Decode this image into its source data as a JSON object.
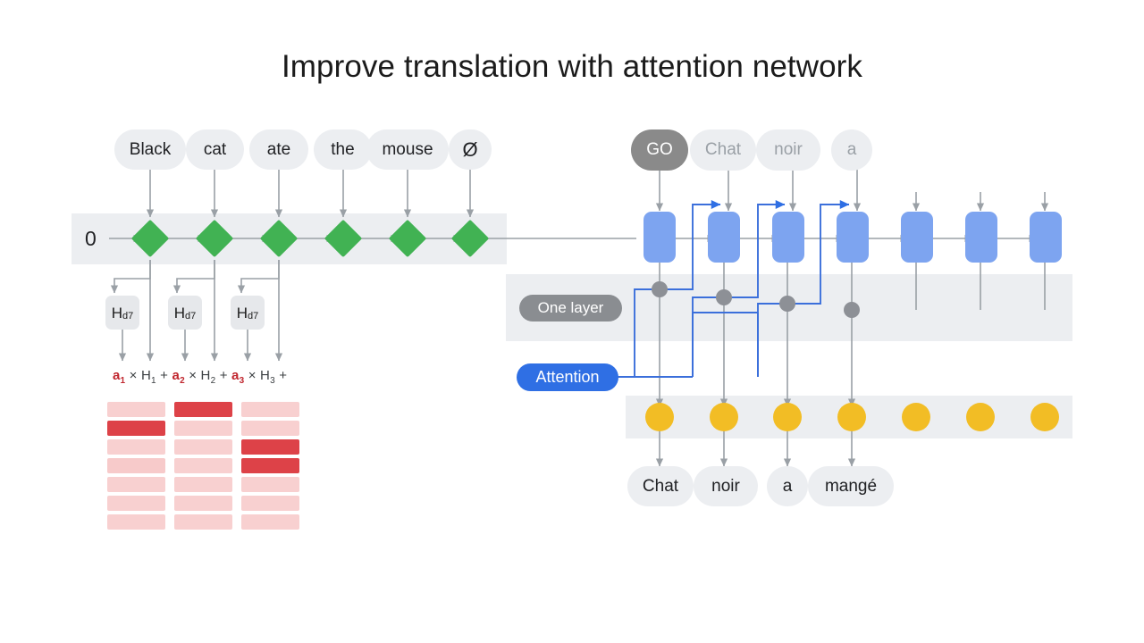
{
  "title": "Improve translation with attention network",
  "colors": {
    "green": "#41b253",
    "blue_cell": "#7da4f0",
    "attention_blue": "#2f6fe4",
    "yellow": "#f2bd25",
    "gray_dot": "#8d9096",
    "band": "#eceef1",
    "pill": "#eceef1",
    "pill_dark": "#8a8a8a",
    "heat_strong": "#dd4248",
    "heat_weak": "#fadcdc",
    "coefficient_red": "#c0262e"
  },
  "encoder": {
    "initial_state": "0",
    "input_tokens": [
      {
        "label": "Black",
        "style": "light"
      },
      {
        "label": "cat",
        "style": "light"
      },
      {
        "label": "ate",
        "style": "light"
      },
      {
        "label": "the",
        "style": "light"
      },
      {
        "label": "mouse",
        "style": "light"
      },
      {
        "label": "Ø",
        "style": "light"
      }
    ],
    "cell_count": 6,
    "hidden_state_boxes": [
      {
        "label": "H",
        "sub": "d7"
      },
      {
        "label": "H",
        "sub": "d7"
      },
      {
        "label": "H",
        "sub": "d7"
      }
    ],
    "formula": [
      {
        "text": "a",
        "sub": "1",
        "kind": "coef"
      },
      {
        "text": " × H",
        "sub": "1",
        "kind": "term"
      },
      {
        "text": " + ",
        "sub": "",
        "kind": "op"
      },
      {
        "text": "a",
        "sub": "2",
        "kind": "coef"
      },
      {
        "text": " × H",
        "sub": "2",
        "kind": "term"
      },
      {
        "text": " + ",
        "sub": "",
        "kind": "op"
      },
      {
        "text": "a",
        "sub": "3",
        "kind": "coef"
      },
      {
        "text": " × H",
        "sub": "3",
        "kind": "term"
      },
      {
        "text": " +",
        "sub": "",
        "kind": "op"
      }
    ]
  },
  "heatmap": {
    "columns": 3,
    "rows": 7,
    "values": [
      [
        0.08,
        1.0,
        0.08,
        0.12,
        0.08,
        0.08,
        0.08
      ],
      [
        1.0,
        0.08,
        0.08,
        0.08,
        0.08,
        0.08,
        0.08
      ],
      [
        0.08,
        0.08,
        1.0,
        1.0,
        0.08,
        0.08,
        0.08
      ]
    ]
  },
  "decoder": {
    "input_tokens": [
      {
        "label": "GO",
        "style": "dark"
      },
      {
        "label": "Chat",
        "style": "muted"
      },
      {
        "label": "noir",
        "style": "muted"
      },
      {
        "label": "a",
        "style": "muted"
      }
    ],
    "cell_count": 7,
    "one_layer_label": "One layer",
    "attention_label": "Attention",
    "dot_count": 4,
    "output_circle_count": 7,
    "output_tokens": [
      {
        "label": "Chat"
      },
      {
        "label": "noir"
      },
      {
        "label": "a"
      },
      {
        "label": "mangé"
      }
    ]
  }
}
